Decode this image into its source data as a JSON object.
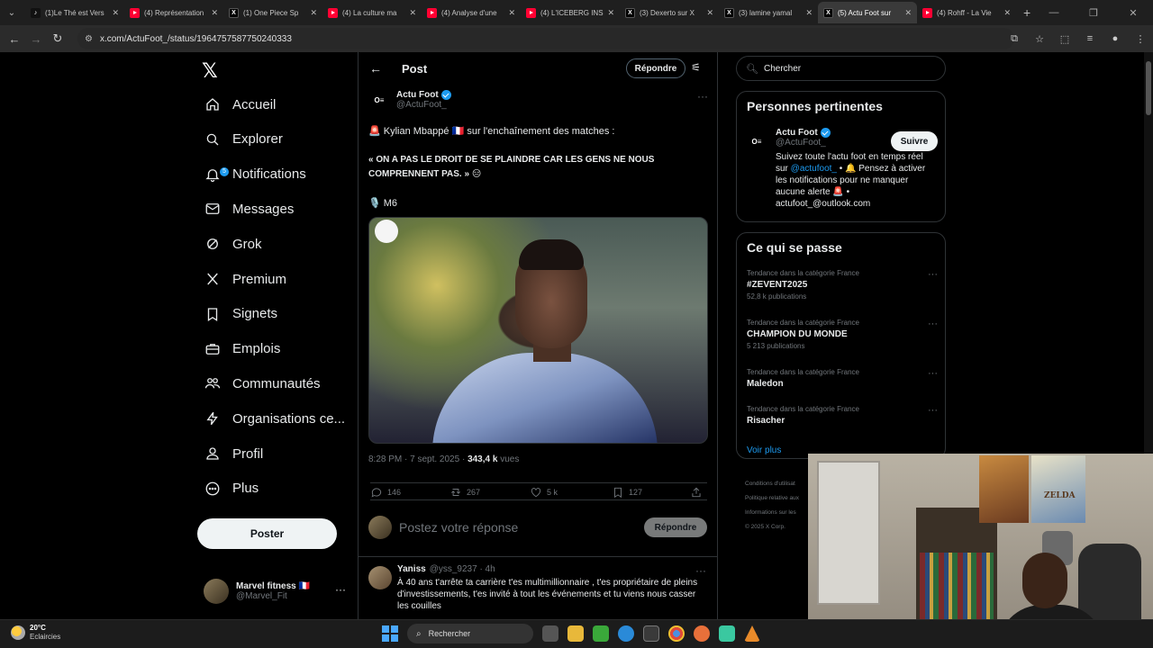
{
  "browser": {
    "tabs": [
      {
        "title": "(1)Le Thé est Vers",
        "fav": "tk"
      },
      {
        "title": "(4) Représentation",
        "fav": "yt"
      },
      {
        "title": "(1) One Piece Sp",
        "fav": "x"
      },
      {
        "title": "(4) La culture ma",
        "fav": "yt"
      },
      {
        "title": "(4) Analyse d'une",
        "fav": "yt"
      },
      {
        "title": "(4) L'ICEBERG INS",
        "fav": "yt"
      },
      {
        "title": "(3) Dexerto sur X",
        "fav": "x"
      },
      {
        "title": "(3) lamine yamal",
        "fav": "x"
      },
      {
        "title": "(5) Actu Foot sur",
        "fav": "x",
        "active": true
      },
      {
        "title": "(4) Rohff - La Vie",
        "fav": "yt"
      }
    ],
    "url": "x.com/ActuFoot_/status/1964757587750240333"
  },
  "nav": {
    "items": [
      {
        "label": "Accueil",
        "icon": "home-icon"
      },
      {
        "label": "Explorer",
        "icon": "search-icon"
      },
      {
        "label": "Notifications",
        "icon": "bell-icon",
        "badge": "5"
      },
      {
        "label": "Messages",
        "icon": "mail-icon"
      },
      {
        "label": "Grok",
        "icon": "grok-icon"
      },
      {
        "label": "Premium",
        "icon": "x-logo-icon"
      },
      {
        "label": "Signets",
        "icon": "bookmark-icon"
      },
      {
        "label": "Emplois",
        "icon": "briefcase-icon"
      },
      {
        "label": "Communautés",
        "icon": "people-icon"
      },
      {
        "label": "Organisations ce...",
        "icon": "lightning-icon"
      },
      {
        "label": "Profil",
        "icon": "person-icon"
      },
      {
        "label": "Plus",
        "icon": "more-circle-icon"
      }
    ],
    "post_button": "Poster",
    "account": {
      "name": "Marvel fitness 🇫🇷",
      "handle": "@Marvel_Fit"
    }
  },
  "post": {
    "header_title": "Post",
    "reply_button": "Répondre",
    "author": {
      "name": "Actu Foot",
      "handle": "@ActuFoot_",
      "avatar_text": "O≡"
    },
    "line1": "🚨 Kylian Mbappé 🇫🇷 sur l'enchaînement des matches :",
    "quote": "« ON A PAS LE DROIT DE SE PLAINDRE CAR LES GENS NE NOUS COMPRENNENT PAS. » 😑",
    "source": "🎙️ M6",
    "time": "8:28 PM · 7 sept. 2025 · ",
    "views_count": "343,4 k",
    "views_label": " vues",
    "stats": {
      "replies": "146",
      "reposts": "267",
      "likes": "5 k",
      "bookmarks": "127"
    },
    "compose_placeholder": "Postez votre réponse",
    "compose_button": "Répondre"
  },
  "reply": {
    "name": "Yaniss",
    "handle": "@yss_9237 · 4h",
    "text": "À 40 ans t'arrête ta carrière t'es multimillionnaire , t'es propriétaire de pleins d'investissements, t'es invité à tout les événements et tu viens nous casser les couilles"
  },
  "sidebar": {
    "search_placeholder": "Chercher",
    "relevant_title": "Personnes pertinentes",
    "person": {
      "name": "Actu Foot",
      "handle": "@ActuFoot_",
      "follow": "Suivre",
      "bio_a": "Suivez toute l'actu foot en temps réel sur ",
      "bio_link": "@actufoot_",
      "bio_b": " • 🔔 Pensez à activer les notifications pour ne manquer aucune alerte 🚨 • actufoot_@outlook.com"
    },
    "trends_title": "Ce qui se passe",
    "trends": [
      {
        "category": "Tendance dans la catégorie France",
        "name": "#ZEVENT2025",
        "posts": "52,8 k publications"
      },
      {
        "category": "Tendance dans la catégorie France",
        "name": "CHAMPION DU MONDE",
        "posts": "5 213 publications"
      },
      {
        "category": "Tendance dans la catégorie France",
        "name": "Maledon",
        "posts": ""
      },
      {
        "category": "Tendance dans la catégorie France",
        "name": "Risacher",
        "posts": ""
      }
    ],
    "see_more": "Voir plus",
    "footer": [
      "Conditions d'utilisat",
      "Politique relative aux",
      "Informations sur les",
      "© 2025 X Corp."
    ]
  },
  "taskbar": {
    "temp": "20°C",
    "weather": "Eclaircies",
    "search": "Rechercher"
  },
  "webcam": {
    "poster_text": "ZELDA"
  }
}
